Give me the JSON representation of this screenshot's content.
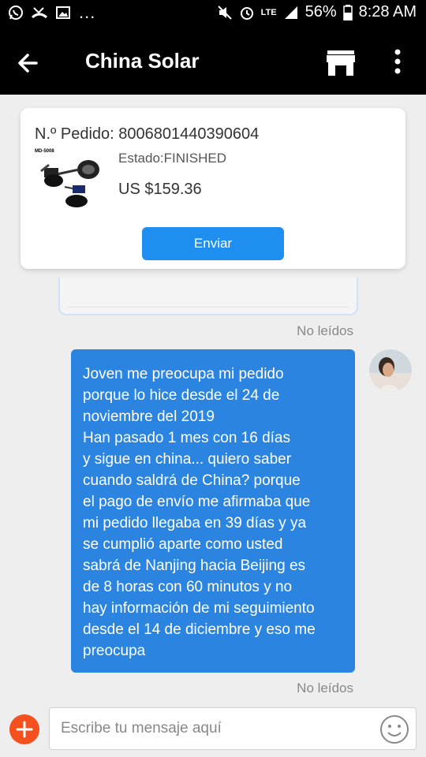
{
  "status_bar": {
    "left_icons": [
      "whatsapp-icon",
      "missed-call-icon",
      "image-icon"
    ],
    "more": "...",
    "right_icons": [
      "mute-icon",
      "alarm-icon",
      "lte-icon",
      "signal-icon",
      "battery-icon"
    ],
    "network": "LTE",
    "battery": "56%",
    "time": "8:28 AM"
  },
  "app_bar": {
    "title": "China Solar",
    "back_icon": "back-arrow-icon",
    "store_icon": "store-icon",
    "more_icon": "more-vert-icon"
  },
  "order": {
    "number": "N.º Pedido: 8006801440390604",
    "product_label": "MD-5008",
    "status": "Estado:FINISHED",
    "price": "US $159.36",
    "send_label": "Enviar"
  },
  "messages": [
    {
      "text": "Joven me preocupa mi pedido\nporque lo hice desde el 24 de\nnoviembre del 2019\nHan pasado 1 mes con 16 días\ny sigue en china... quiero saber\ncuando saldrá de China? porque\nel pago de envío me afirmaba que\nmi pedido llegaba en 39 días y ya\nse cumplió aparte como usted\nsabrá de Nanjing hacia Beijing es\nde 8 horas con 60 minutos y no\nhay información de mi seguimiento\ndesde el 14 de diciembre y eso me\npreocupa",
      "status": "No leídos"
    }
  ],
  "previous_message_status": "No leídos",
  "composer": {
    "placeholder": "Escribe tu mensaje aquí",
    "add_icon": "add-icon",
    "emoji_icon": "emoji-icon"
  },
  "colors": {
    "bubble": "#2b84e0",
    "button": "#1e8ff0",
    "add_button": "#f4511e",
    "app_bar": "#000000"
  }
}
